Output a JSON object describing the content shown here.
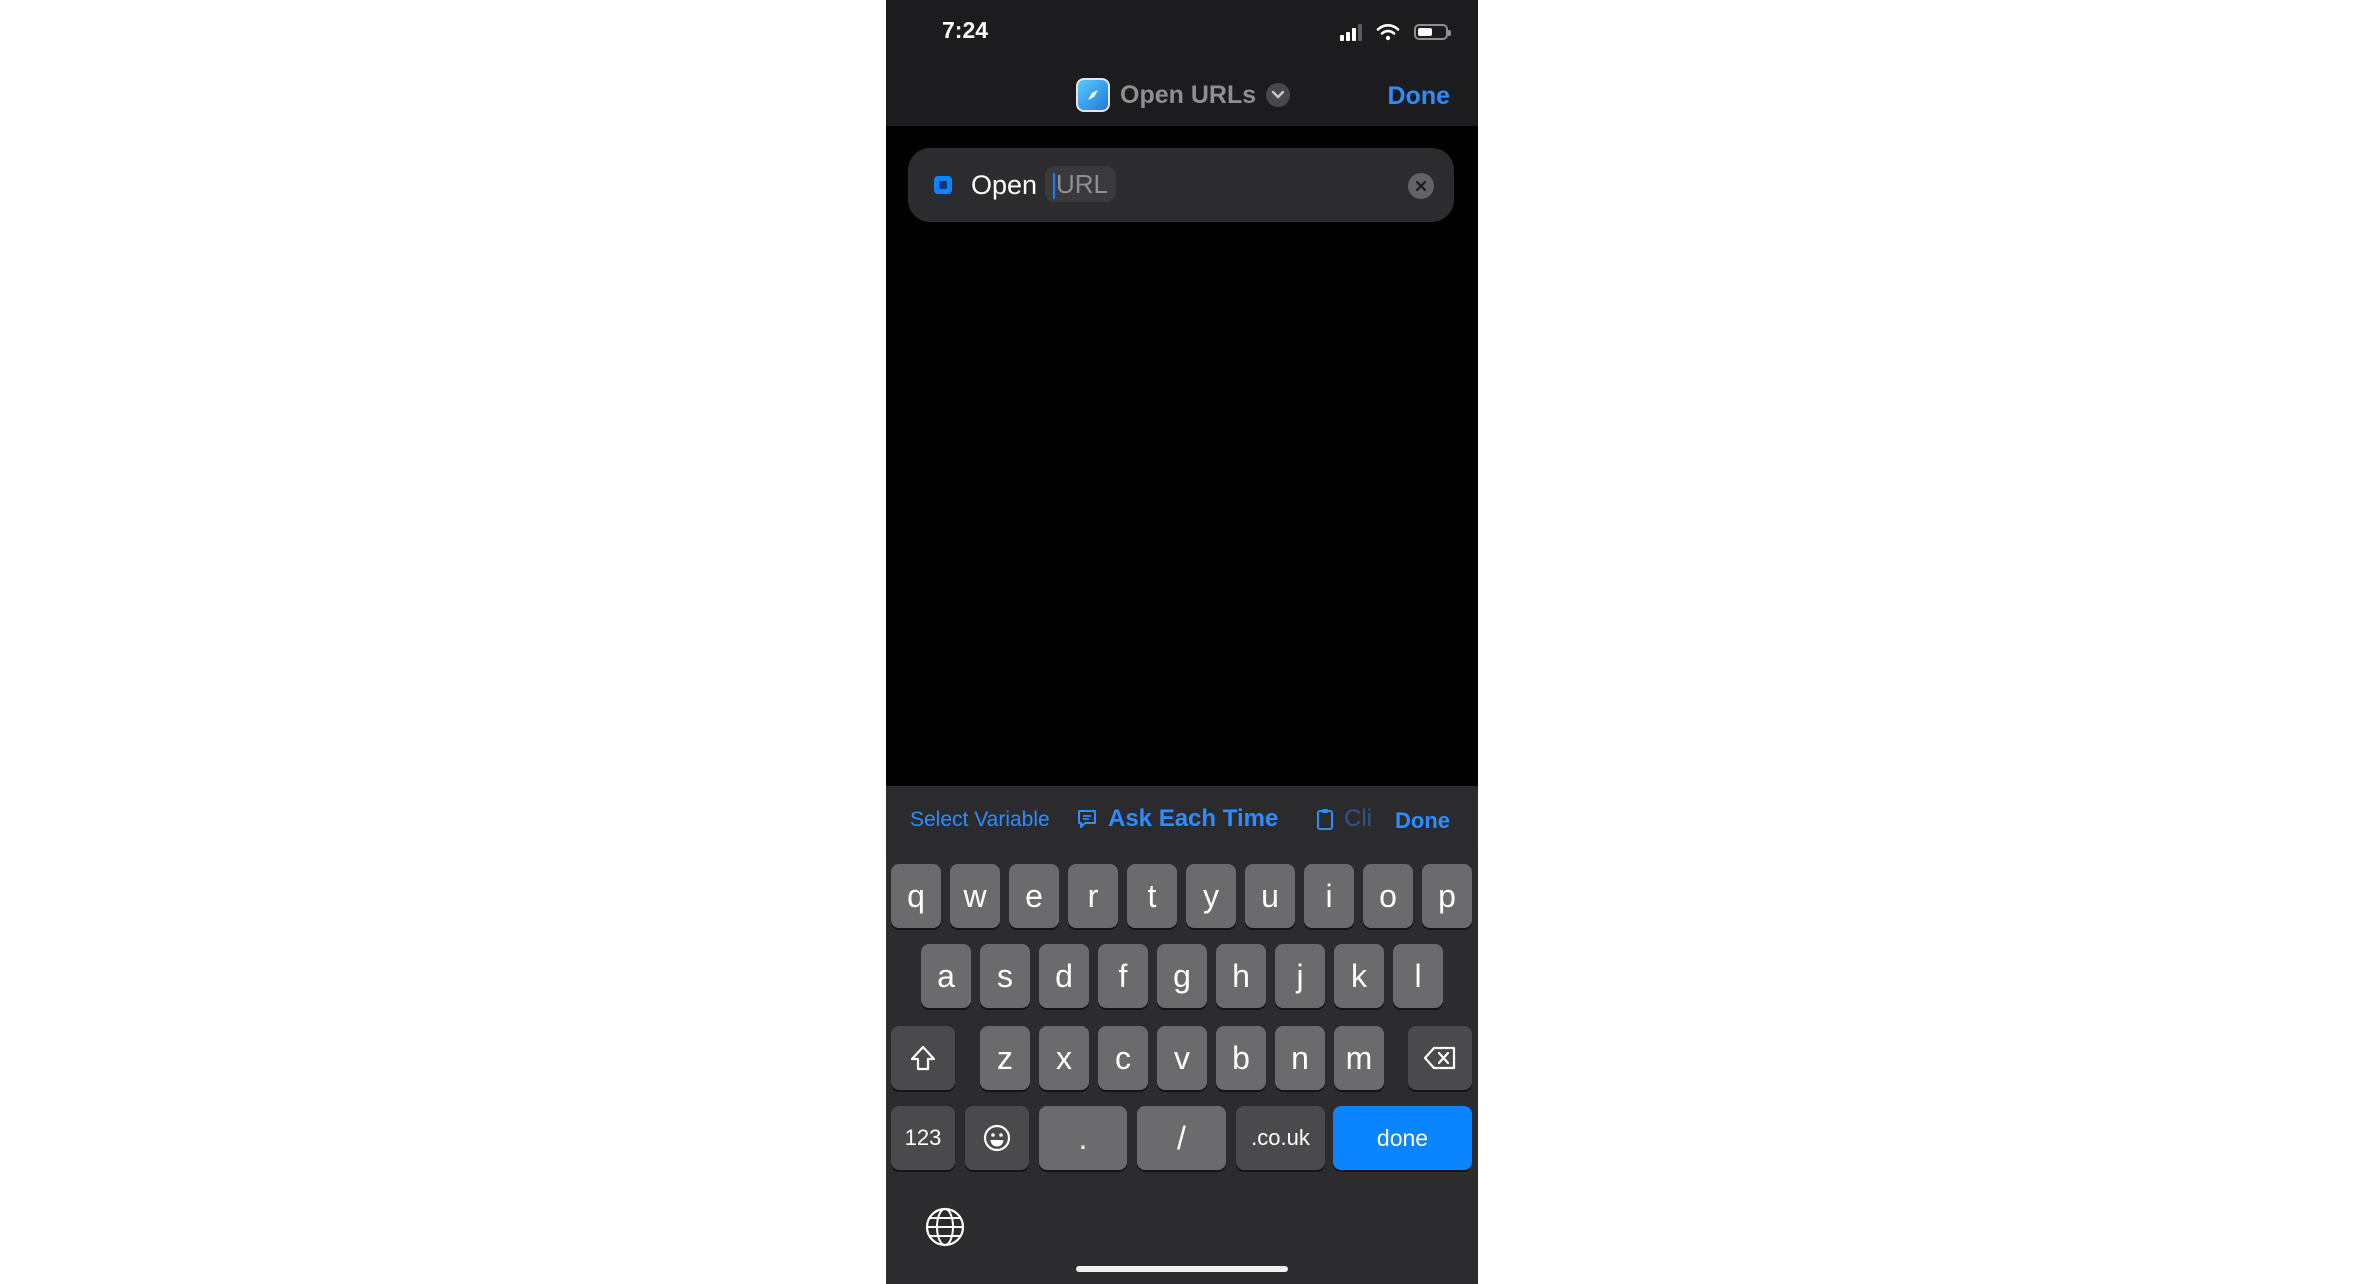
{
  "status_bar": {
    "time": "7:24"
  },
  "nav": {
    "title": "Open URLs",
    "done_label": "Done"
  },
  "action_card": {
    "verb": "Open",
    "url_placeholder": "URL"
  },
  "toolbar": {
    "select_variable": "Select Variable",
    "ask_each_time": "Ask Each Time",
    "clipboard_partial": "Cli",
    "done": "Done"
  },
  "keyboard": {
    "row1": [
      "q",
      "w",
      "e",
      "r",
      "t",
      "y",
      "u",
      "i",
      "o",
      "p"
    ],
    "row2": [
      "a",
      "s",
      "d",
      "f",
      "g",
      "h",
      "j",
      "k",
      "l"
    ],
    "row3": [
      "z",
      "x",
      "c",
      "v",
      "b",
      "n",
      "m"
    ],
    "numbers_key": "123",
    "dot_key": ".",
    "slash_key": "/",
    "domain_key": ".co.uk",
    "done_key": "done"
  },
  "colors": {
    "accent": "#0a84ff",
    "key": "#6b6b6e",
    "key_dark": "#4a4a4c",
    "background": "#000000"
  }
}
